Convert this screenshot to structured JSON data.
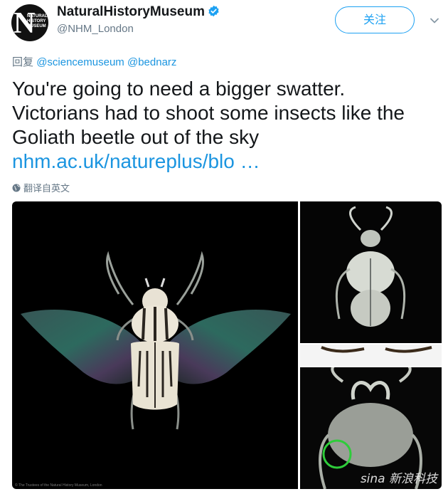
{
  "account": {
    "display_name": "NaturalHistoryMuseum",
    "handle": "@NHM_London",
    "avatar_text": [
      "NATURAL",
      "HISTORY",
      "MUSEUM"
    ],
    "verified": true
  },
  "follow_button": {
    "label": "关注"
  },
  "reply": {
    "prefix": "回复",
    "mentions": [
      "@sciencemuseum",
      "@bednarz"
    ]
  },
  "tweet": {
    "lines": [
      "You're going to need a bigger swatter.",
      "Victorians had to shoot some insects like the",
      "Goliath beetle out of the sky"
    ],
    "link": "nhm.ac.uk/natureplus/blo …"
  },
  "translate": {
    "label": "翻译自英文",
    "icon": "globe-icon"
  },
  "media": {
    "credit": "© The Trustees of the Natural History Museum, London",
    "watermark": "sina 新浪科技"
  },
  "colors": {
    "accent": "#1da1f2",
    "link": "#1b95e0",
    "muted": "#657786",
    "text": "#14171a",
    "highlight_circle": "#2ecc3a"
  }
}
